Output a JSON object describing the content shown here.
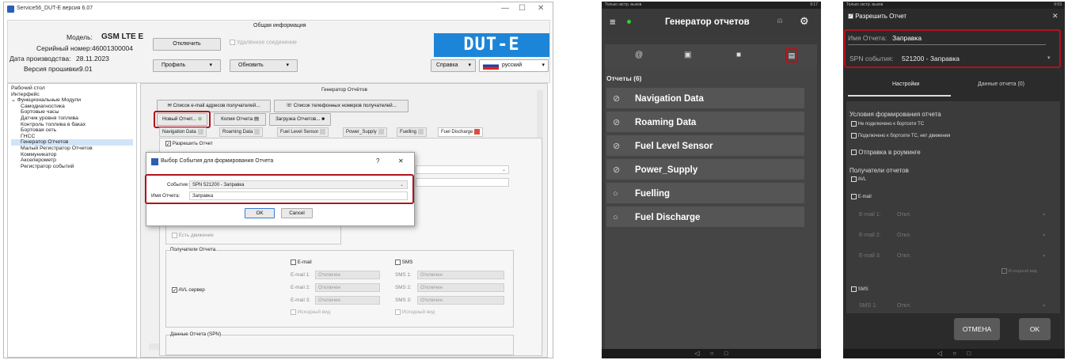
{
  "win": {
    "title": "Service56_DUT-E версия 6.07",
    "info_header": "Общая информация",
    "model_label": "Модель:",
    "model_value": "GSM LTE E",
    "serial_label": "Серийный номер:",
    "serial_value": "46001300004",
    "date_label": "Дата производства:",
    "date_value": "28.11.2023",
    "fw_label": "Версия прошивки:",
    "fw_value": "9.01",
    "disconnect_btn": "Отключить",
    "remote_label": "Удалённое соединение",
    "profile_btn": "Профиль",
    "refresh_btn": "Обновить",
    "help_btn": "Справка",
    "lang": "русский",
    "logo": "DUT-E",
    "tree": [
      "Рабочий стол",
      "Интерфейс",
      "Функциональные Модули",
      "Самодиагностика",
      "Бортовые часы",
      "Датчик уровня топлива",
      "Контроль топлива в баках",
      "Бортовая сеть",
      "ГНСС",
      "Генератор Отчетов",
      "Малый Регистратор Отчетов",
      "Коммуникатор",
      "Акселерометр",
      "Регистратор событий"
    ],
    "gen_title": "Генератор Отчётов",
    "email_list_btn": "Список e-mail адресов получателей...",
    "phone_list_btn": "Список телефонных номеров получателей...",
    "new_report_btn": "Новый Отчет...",
    "copy_report_btn": "Копия Отчета",
    "load_reports_btn": "Загрузка Отчетов...",
    "tabs": [
      "Navigation Data",
      "Roaming Data",
      "Fuel Level Sensor",
      "Power_Supply",
      "Fuelling",
      "Fuel Discharge"
    ],
    "allow_report": "Разрешить Отчет",
    "has_motion": "Есть движение",
    "recipients_title": "Получатели Отчета",
    "avl_server": "AVL сервер",
    "email_label": "E-mail",
    "sms_label": "SMS",
    "email_rows": [
      "E-mail 1:",
      "E-mail 2:",
      "E-mail 3:"
    ],
    "sms_rows": [
      "SMS 1:",
      "SMS 2:",
      "SMS 3:"
    ],
    "off": "Отключен",
    "raw_view": "Исходный вид",
    "report_data_title": "Данные Отчета (SPN)",
    "dialog": {
      "title": "Выбор События для формирования Отчета",
      "help": "?",
      "close": "✕",
      "event_label": "Событие:",
      "event_value": "SPN 521200 - Заправка",
      "name_label": "Имя Отчета:",
      "name_value": "Заправка",
      "ok": "OK",
      "cancel": "Cancel"
    }
  },
  "phone_list": {
    "status_left": "Только экстр. вызов",
    "status_right": "9:17",
    "title": "Генератор отчетов",
    "reports_header": "Отчеты (6)",
    "reports": [
      "Navigation Data",
      "Roaming Data",
      "Fuel Level Sensor",
      "Power_Supply",
      "Fuelling",
      "Fuel Discharge"
    ]
  },
  "phone_edit": {
    "status_left": "Только экстр. вызов",
    "status_right": "9:53",
    "allow_report": "Разрешить Отчет",
    "name_label": "Имя Отчета:",
    "name_value": "Заправка",
    "spn_label": "SPN события:",
    "spn_value": "521200 - Заправка",
    "tab_settings": "Настройки",
    "tab_data": "Данные отчета (0)",
    "conditions_title": "Условия формирования отчета",
    "cond_1": "Не подключено к бортсети ТС",
    "cond_2": "Подключено к бортсети ТС, нет движения",
    "roaming": "Отправка в роуминге",
    "recipients": "Получатели отчетов",
    "avl": "AVL",
    "email": "E-mail",
    "email_rows": [
      "E-mail 1:",
      "E-mail 2:",
      "E-mail 3:"
    ],
    "off": "Откл.",
    "raw_view": "Исходный вид",
    "sms": "SMS",
    "sms_row": "SMS 1:",
    "cancel": "ОТМЕНА",
    "ok": "OK"
  },
  "colors": {
    "accent_red": "#b3121b",
    "logo_blue": "#1d85d8",
    "phone_bg": "#3b3b3b"
  }
}
